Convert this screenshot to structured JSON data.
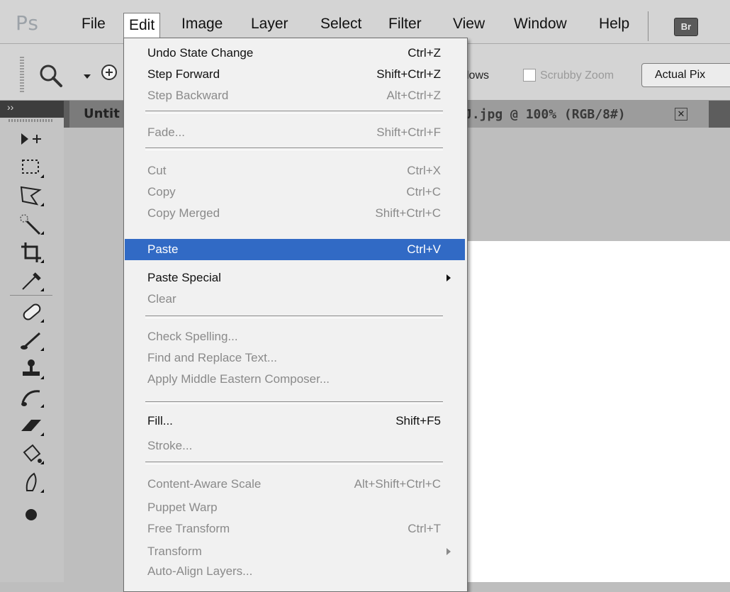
{
  "app": {
    "logo": "Ps"
  },
  "menubar": {
    "items": [
      "File",
      "Edit",
      "Image",
      "Layer",
      "Select",
      "Filter",
      "View",
      "Window",
      "Help"
    ],
    "active": "Edit",
    "bridge_label": "Br"
  },
  "options": {
    "windows_label": "lows",
    "scrubby_zoom_label": "Scrubby Zoom",
    "scrubby_zoom_checked": false,
    "actual_pixels_label": "Actual Pix"
  },
  "tabs": {
    "left_tab_label": "Untit",
    "doc_tab_label": "J.jpg @ 100% (RGB/8#)"
  },
  "tools_panel": {
    "collapse_label": "››",
    "tools": [
      "move-tool",
      "rectangular-marquee-tool",
      "polygonal-lasso-tool",
      "magic-wand-tool",
      "crop-tool",
      "eyedropper-tool",
      "spot-healing-brush-tool",
      "brush-tool",
      "clone-stamp-tool",
      "history-brush-tool",
      "eraser-tool",
      "paint-bucket-tool",
      "blur-tool",
      "dodge-tool"
    ]
  },
  "edit_menu": {
    "items": [
      {
        "label": "Undo State Change",
        "shortcut": "Ctrl+Z",
        "enabled": true
      },
      {
        "label": "Step Forward",
        "shortcut": "Shift+Ctrl+Z",
        "enabled": true
      },
      {
        "label": "Step Backward",
        "shortcut": "Alt+Ctrl+Z",
        "enabled": false
      },
      {
        "label": "Fade...",
        "shortcut": "Shift+Ctrl+F",
        "enabled": false
      },
      {
        "label": "Cut",
        "shortcut": "Ctrl+X",
        "enabled": false
      },
      {
        "label": "Copy",
        "shortcut": "Ctrl+C",
        "enabled": false
      },
      {
        "label": "Copy Merged",
        "shortcut": "Shift+Ctrl+C",
        "enabled": false
      },
      {
        "label": "Paste",
        "shortcut": "Ctrl+V",
        "enabled": true,
        "highlighted": true
      },
      {
        "label": "Paste Special",
        "shortcut": "",
        "enabled": true,
        "submenu": true
      },
      {
        "label": "Clear",
        "shortcut": "",
        "enabled": false
      },
      {
        "label": "Check Spelling...",
        "shortcut": "",
        "enabled": false
      },
      {
        "label": "Find and Replace Text...",
        "shortcut": "",
        "enabled": false
      },
      {
        "label": "Apply Middle Eastern Composer...",
        "shortcut": "",
        "enabled": false
      },
      {
        "label": "Fill...",
        "shortcut": "Shift+F5",
        "enabled": true
      },
      {
        "label": "Stroke...",
        "shortcut": "",
        "enabled": false
      },
      {
        "label": "Content-Aware Scale",
        "shortcut": "Alt+Shift+Ctrl+C",
        "enabled": false
      },
      {
        "label": "Puppet Warp",
        "shortcut": "",
        "enabled": false
      },
      {
        "label": "Free Transform",
        "shortcut": "Ctrl+T",
        "enabled": false
      },
      {
        "label": "Transform",
        "shortcut": "",
        "enabled": false,
        "submenu": true
      },
      {
        "label": "Auto-Align Layers...",
        "shortcut": "",
        "enabled": false
      }
    ]
  },
  "colors": {
    "highlight": "#316ac5",
    "disabled_text": "#8a8a8a"
  }
}
